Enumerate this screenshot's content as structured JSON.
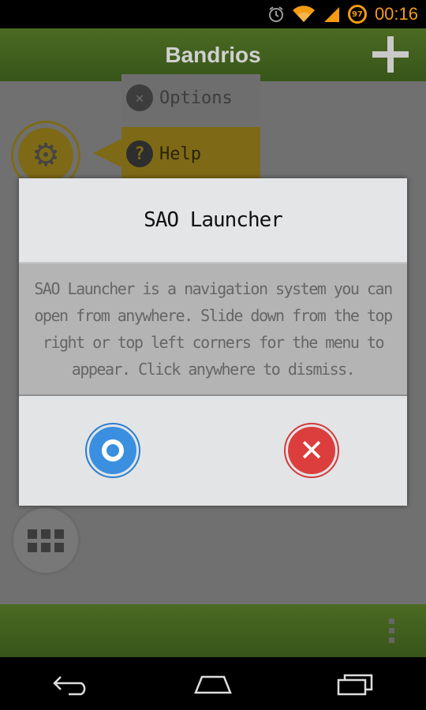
{
  "status_bar": {
    "time": "00:16",
    "battery_level": "97",
    "icons": [
      "alarm-icon",
      "wifi-icon",
      "signal-icon",
      "battery-icon"
    ]
  },
  "app_bar": {
    "title": "Bandrios",
    "action_icon": "plus-icon"
  },
  "background_menu": {
    "items": [
      {
        "label": "Options",
        "icon": "tools-icon"
      },
      {
        "label": "Help",
        "icon": "help-icon"
      }
    ],
    "gear_icon": "gear-icon",
    "grid_icon": "apps-grid-icon"
  },
  "dialog": {
    "title": "SAO Launcher",
    "message": "SAO Launcher is a navigation system you can open from anywhere. Slide down from the top right or top left corners for the menu to appear. Click anywhere to dismiss.",
    "ok_icon": "ok-circle-icon",
    "cancel_icon": "close-icon"
  },
  "nav_bar": {
    "buttons": [
      "back-icon",
      "home-icon",
      "recents-icon"
    ]
  },
  "colors": {
    "accent": "#f39c12",
    "bar_green": "#4b6a22",
    "ok_blue": "#3a8fe0",
    "cancel_red": "#dc3e3e"
  }
}
